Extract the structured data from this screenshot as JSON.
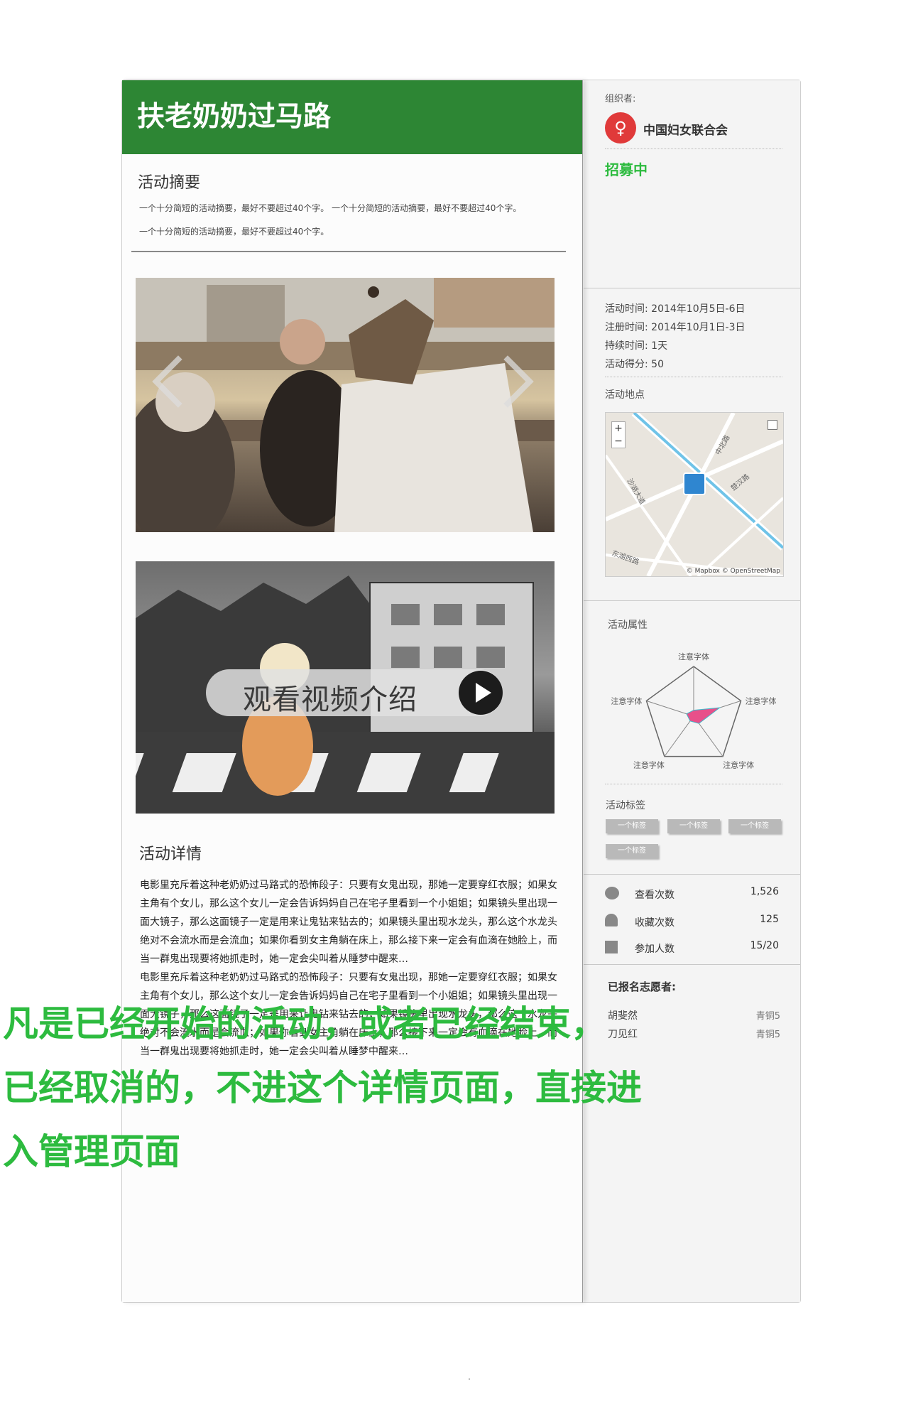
{
  "activity": {
    "title": "扶老奶奶过马路",
    "summary_heading": "活动摘要",
    "summary_lines": [
      "一个十分简短的活动摘要，最好不要超过40个字。 一个十分简短的活动摘要，最好不要超过40个字。",
      "一个十分简短的活动摘要，最好不要超过40个字。"
    ],
    "video_label": "观看视频介绍",
    "details_heading": "活动详情",
    "details_paragraphs": [
      "电影里充斥着这种老奶奶过马路式的恐怖段子：只要有女鬼出现，那她一定要穿红衣服；如果女主角有个女儿，那么这个女儿一定会告诉妈妈自己在宅子里看到一个小姐姐；如果镜头里出现一面大镜子，那么这面镜子一定是用来让鬼钻来钻去的；如果镜头里出现水龙头，那么这个水龙头绝对不会流水而是会流血；如果你看到女主角躺在床上，那么接下来一定会有血滴在她脸上，而当一群鬼出现要将她抓走时，她一定会尖叫着从睡梦中醒来…",
      "电影里充斥着这种老奶奶过马路式的恐怖段子：只要有女鬼出现，那她一定要穿红衣服；如果女主角有个女儿，那么这个女儿一定会告诉妈妈自己在宅子里看到一个小姐姐；如果镜头里出现一面大镜子，那么这面镜子一定是用来让鬼钻来钻去的；如果镜头里出现水龙头，那么这个水龙头绝对不会流水而是会流血；如果你看到女主角躺在床上，那么接下来一定会有血滴在她脸上，而当一群鬼出现要将她抓走时，她一定会尖叫着从睡梦中醒来…"
    ]
  },
  "annotation_lines": [
    "凡是已经开始的活动，或者已经结束，",
    "已经取消的，不进这个详情页面，直接进",
    "入管理页面"
  ],
  "sidebar": {
    "organizer_label": "组织者:",
    "organizer_name": "中国妇女联合会",
    "status": "招募中",
    "info": {
      "time_label": "活动时间:",
      "time_value": "2014年10月5日-6日",
      "reg_label": "注册时间:",
      "reg_value": "2014年10月1日-3日",
      "duration_label": "持续时间:",
      "duration_value": "1天",
      "score_label": "活动得分:",
      "score_value": "50"
    },
    "location_label": "活动地点",
    "map": {
      "zoom_in": "+",
      "zoom_out": "−",
      "credit": "© Mapbox © OpenStreetMap",
      "streets": [
        "沙湖大道",
        "中北路",
        "楚汉路",
        "东湖西路"
      ]
    },
    "attributes_label": "活动属性",
    "radar_axis_labels": [
      "注意字体",
      "注意字体",
      "注意字体",
      "注意字体",
      "注意字体"
    ],
    "radar_values": [
      0.12,
      0.55,
      0.18,
      0.12,
      0.15
    ],
    "tags_label": "活动标签",
    "tags": [
      "一个标签",
      "一个标签",
      "一个标签",
      "一个标签"
    ],
    "stats": {
      "views_label": "查看次数",
      "views_value": "1,526",
      "favorites_label": "收藏次数",
      "favorites_value": "125",
      "participants_label": "参加人数",
      "participants_value": "15/20"
    },
    "volunteers_label": "已报名志愿者:",
    "volunteers": [
      {
        "name": "胡斐然",
        "level": "青铜5"
      },
      {
        "name": "刀见红",
        "level": "青铜5"
      }
    ]
  },
  "colors": {
    "title_bar": "#2d8634",
    "status": "#2dbb3f",
    "annotation": "#2dbb3f",
    "radar_fill": "#e8508a"
  },
  "icons": [
    "chevron-left-icon",
    "chevron-right-icon",
    "play-icon",
    "eye-icon",
    "heart-icon",
    "gamepad-icon",
    "map-pin-icon",
    "expand-icon"
  ]
}
